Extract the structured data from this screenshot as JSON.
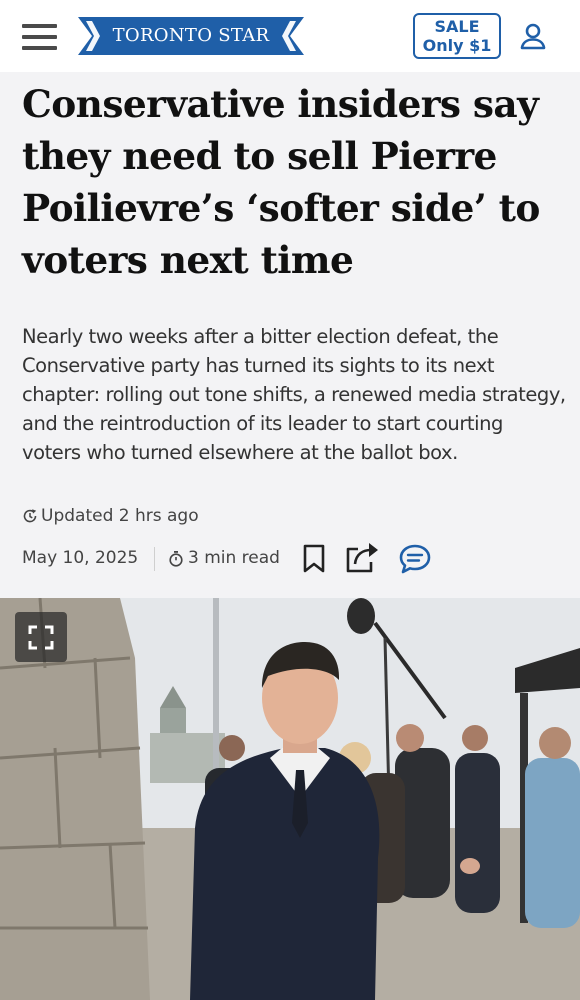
{
  "header": {
    "menu_icon": "hamburger-menu-icon",
    "logo_text": "TORONTO STAR",
    "sale_line1": "SALE",
    "sale_line2": "Only $1",
    "account_icon": "user-account-icon"
  },
  "article": {
    "headline": "Conservative insiders say they need to sell Pierre Poilievre’s ‘softer side’ to voters next time",
    "summary": "Nearly two weeks after a bitter election defeat, the Conservative party has turned its sights to its next chapter: rolling out tone shifts, a renewed media strategy, and the reintroduction of its leader to start courting voters who turned elsewhere at the ballot box.",
    "updated": "Updated 2 hrs ago",
    "date": "May 10, 2025",
    "read_time": "3 min read"
  },
  "actions": {
    "bookmark_icon": "bookmark-icon",
    "share_icon": "share-icon",
    "comment_icon": "comment-icon"
  },
  "photo": {
    "expand_icon": "expand-fullscreen-icon"
  },
  "colors": {
    "brand_blue": "#1f5fa8",
    "background": "#f3f3f5",
    "headline": "#111111",
    "body_text": "#333333"
  }
}
